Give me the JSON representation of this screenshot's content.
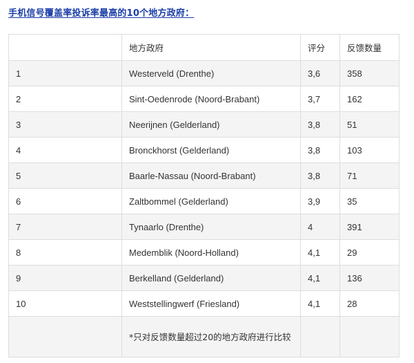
{
  "heading": "手机信号覆盖率投诉率最高的10个地方政府：",
  "table": {
    "headers": [
      "",
      "地方政府",
      "评分",
      "反馈数量"
    ],
    "rows": [
      {
        "rank": "1",
        "municipality": "Westerveld (Drenthe)",
        "score": "3,6",
        "feedback": "358"
      },
      {
        "rank": "2",
        "municipality": "Sint-Oedenrode (Noord-Brabant)",
        "score": "3,7",
        "feedback": "162"
      },
      {
        "rank": "3",
        "municipality": "Neerijnen (Gelderland)",
        "score": "3,8",
        "feedback": "51"
      },
      {
        "rank": "4",
        "municipality": "Bronckhorst (Gelderland)",
        "score": "3,8",
        "feedback": "103"
      },
      {
        "rank": "5",
        "municipality": "Baarle-Nassau (Noord-Brabant)",
        "score": "3,8",
        "feedback": "71"
      },
      {
        "rank": "6",
        "municipality": "Zaltbommel (Gelderland)",
        "score": "3,9",
        "feedback": "35"
      },
      {
        "rank": "7",
        "municipality": "Tynaarlo (Drenthe)",
        "score": "4",
        "feedback": "391"
      },
      {
        "rank": "8",
        "municipality": "Medemblik (Noord-Holland)",
        "score": "4,1",
        "feedback": "29"
      },
      {
        "rank": "9",
        "municipality": "Berkelland (Gelderland)",
        "score": "4,1",
        "feedback": "136"
      },
      {
        "rank": "10",
        "municipality": "Weststellingwerf (Friesland)",
        "score": "4,1",
        "feedback": "28"
      }
    ],
    "footnote": "*只对反馈数量超过20的地方政府进行比较"
  }
}
